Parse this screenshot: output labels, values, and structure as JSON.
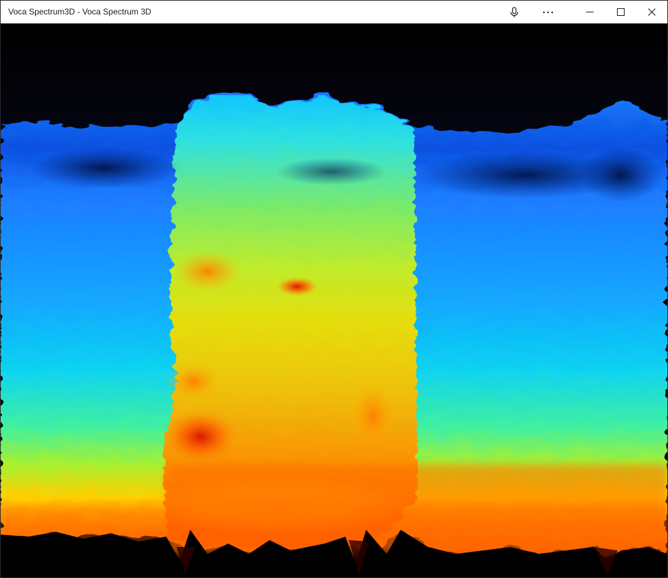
{
  "window": {
    "title": "Voca Spectrum3D - Voca Spectrum 3D"
  },
  "titlebar": {
    "icons": {
      "mic": "microphone-icon",
      "more": "more-options-icon",
      "minimize": "minimize-icon",
      "maximize": "maximize-icon",
      "close": "close-icon"
    }
  },
  "colors": {
    "titlebar_bg": "#ffffff",
    "background": "#000000",
    "spectrum_low": "#1e6fff",
    "spectrum_mid": "#c8f020",
    "spectrum_high": "#ff6a00",
    "spectrum_peak": "#c81400"
  }
}
